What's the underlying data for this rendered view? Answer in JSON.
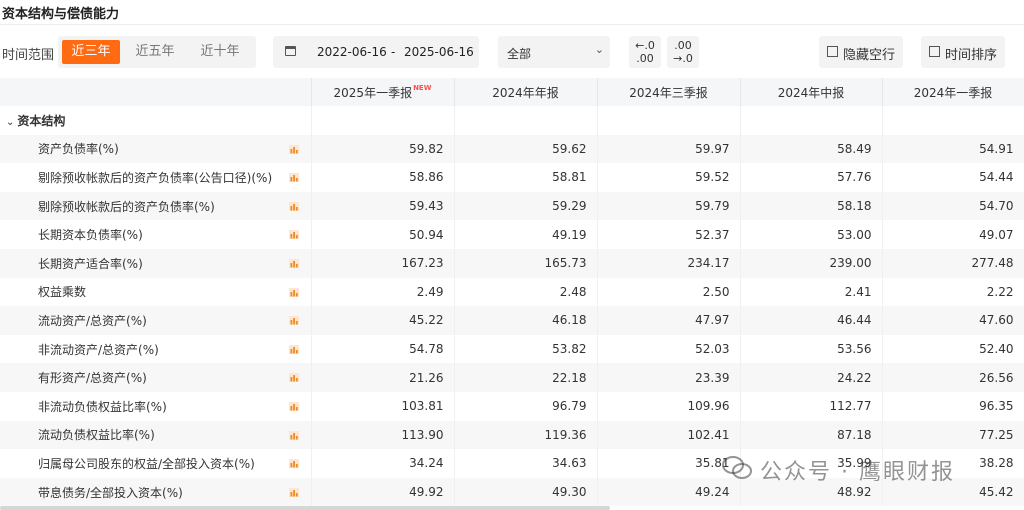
{
  "page": {
    "title": "资本结构与偿债能力"
  },
  "filters": {
    "range_label": "时间范围",
    "range_options": [
      "近三年",
      "近五年",
      "近十年"
    ],
    "date_start": "2022-06-16",
    "date_sep": "-",
    "date_end": "2025-06-16",
    "report_type": "全部",
    "decimal_more": {
      "line1": "←.0",
      "line2": ".00"
    },
    "decimal_less": {
      "line1": ".00",
      "line2": "→.0"
    },
    "hide_empty": "隐藏空行",
    "time_sort": "时间排序"
  },
  "table": {
    "columns": [
      "2025年一季报",
      "2024年年报",
      "2024年三季报",
      "2024年中报",
      "2024年一季报"
    ],
    "new_tag": "NEW",
    "section": "资本结构",
    "rows": [
      {
        "name": "资产负债率(%)",
        "values": [
          "59.82",
          "59.62",
          "59.97",
          "58.49",
          "54.91"
        ]
      },
      {
        "name": "剔除预收帐款后的资产负债率(公告口径)(%)",
        "values": [
          "58.86",
          "58.81",
          "59.52",
          "57.76",
          "54.44"
        ]
      },
      {
        "name": "剔除预收帐款后的资产负债率(%)",
        "values": [
          "59.43",
          "59.29",
          "59.79",
          "58.18",
          "54.70"
        ]
      },
      {
        "name": "长期资本负债率(%)",
        "values": [
          "50.94",
          "49.19",
          "52.37",
          "53.00",
          "49.07"
        ]
      },
      {
        "name": "长期资产适合率(%)",
        "values": [
          "167.23",
          "165.73",
          "234.17",
          "239.00",
          "277.48"
        ]
      },
      {
        "name": "权益乘数",
        "values": [
          "2.49",
          "2.48",
          "2.50",
          "2.41",
          "2.22"
        ]
      },
      {
        "name": "流动资产/总资产(%)",
        "values": [
          "45.22",
          "46.18",
          "47.97",
          "46.44",
          "47.60"
        ]
      },
      {
        "name": "非流动资产/总资产(%)",
        "values": [
          "54.78",
          "53.82",
          "52.03",
          "53.56",
          "52.40"
        ]
      },
      {
        "name": "有形资产/总资产(%)",
        "values": [
          "21.26",
          "22.18",
          "23.39",
          "24.22",
          "26.56"
        ]
      },
      {
        "name": "非流动负债权益比率(%)",
        "values": [
          "103.81",
          "96.79",
          "109.96",
          "112.77",
          "96.35"
        ]
      },
      {
        "name": "流动负债权益比率(%)",
        "values": [
          "113.90",
          "119.36",
          "102.41",
          "87.18",
          "77.25"
        ]
      },
      {
        "name": "归属母公司股东的权益/全部投入资本(%)",
        "values": [
          "34.24",
          "34.63",
          "35.81",
          "35.99",
          "38.28"
        ]
      },
      {
        "name": "带息债务/全部投入资本(%)",
        "values": [
          "49.92",
          "49.30",
          "49.24",
          "48.92",
          "45.42"
        ]
      }
    ]
  },
  "watermark": {
    "text": "公众号 · 鹰眼财报"
  },
  "colors": {
    "accent": "#ff6a13",
    "chart_icon": "#f08a24",
    "header_bg": "#f5f6f8"
  }
}
